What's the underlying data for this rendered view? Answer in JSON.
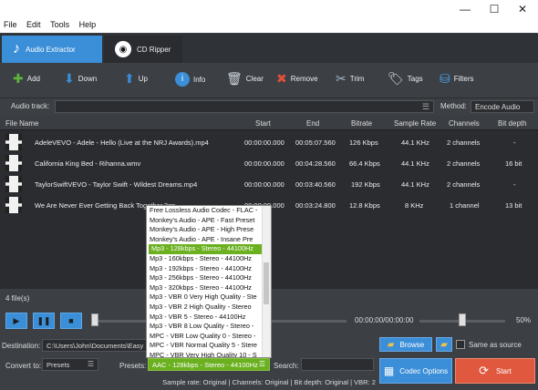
{
  "menu": [
    "File",
    "Edit",
    "Tools",
    "Help"
  ],
  "window_controls": {
    "minimize": "—",
    "maximize": "☐",
    "close": "✕"
  },
  "tabs": [
    {
      "label": "Audio Extractor",
      "icon": "music-note-icon",
      "active": true
    },
    {
      "label": "CD Ripper",
      "icon": "cd-icon",
      "active": false
    }
  ],
  "toolbar": {
    "add": "Add",
    "down": "Down",
    "up": "Up",
    "info": "Info",
    "clear": "Clear",
    "remove": "Remove",
    "trim": "Trim",
    "tags": "Tags",
    "filters": "Filters"
  },
  "audio_track": {
    "label": "Audio track:",
    "method_label": "Method:",
    "method_value": "Encode Audio"
  },
  "columns": {
    "file_name": "File Name",
    "start": "Start",
    "end": "End",
    "bitrate": "Bitrate",
    "sample_rate": "Sample Rate",
    "channels": "Channels",
    "bit_depth": "Bit depth"
  },
  "rows": [
    {
      "name": "AdeleVEVO - Adele - Hello (Live at the NRJ Awards).mp4",
      "start": "00:00:00.000",
      "end": "00:05:07.560",
      "bitrate": "126 Kbps",
      "sample_rate": "44.1 KHz",
      "channels": "2 channels",
      "bit_depth": "-"
    },
    {
      "name": "California King Bed - Rihanna.wmv",
      "start": "00:00:00.000",
      "end": "00:04:28.560",
      "bitrate": "66.4 Kbps",
      "sample_rate": "44.1 KHz",
      "channels": "2 channels",
      "bit_depth": "16 bit"
    },
    {
      "name": "TaylorSwiftVEVO - Taylor Swift - Wildest Dreams.mp4",
      "start": "00:00:00.000",
      "end": "00:03:40.560",
      "bitrate": "192 Kbps",
      "sample_rate": "44.1 KHz",
      "channels": "2 channels",
      "bit_depth": "-"
    },
    {
      "name": "We Are Never Ever Getting Back Together.3gp",
      "start": "00:00:00.000",
      "end": "00:03:24.800",
      "bitrate": "12.8 Kbps",
      "sample_rate": "8 KHz",
      "channels": "1 channel",
      "bit_depth": "13 bit"
    }
  ],
  "file_count": "4 file(s)",
  "player": {
    "time": "00:00:00/00:00:00",
    "volume": "50%",
    "volume_level": 0.5
  },
  "destination": {
    "label": "Destination:",
    "path": "C:\\Users\\John\\Documents\\Easy",
    "browse": "Browse",
    "same_as_source": "Same as source"
  },
  "convert_to": {
    "label": "Convert to:",
    "value": "Presets"
  },
  "presets": {
    "label": "Presets:",
    "value": "AAC - 128kbps - Stereo - 44100Hz",
    "search_label": "Search:"
  },
  "codec_options": "Codec Options",
  "start_button": "Start",
  "status_bar": "Sample rate: Original | Channels: Original | Bit depth: Original | VBR: 2",
  "preset_options": [
    "Free Lossless Audio Codec - FLAC -",
    "Monkey's Audio - APE - Fast Preset",
    "Monkey's Audio - APE - High Prese",
    "Monkey's Audio - APE - Insane Pre",
    "Mp3 - 128kbps - Stereo - 44100Hz",
    "Mp3 - 160kbps - Stereo - 44100Hz",
    "Mp3 - 192kbps - Stereo - 44100Hz",
    "Mp3 - 256kbps - Stereo - 44100Hz",
    "Mp3 - 320kbps - Stereo - 44100Hz",
    "Mp3 - VBR 0 Very High Quality - Ste",
    "Mp3 - VBR 2 High Quality - Stereo",
    "Mp3 - VBR 5 - Stereo - 44100Hz",
    "Mp3 - VBR 8 Low Quality - Stereo -",
    "MPC - VBR Low Quality 0 - Stereo -",
    "MPC - VBR Normal Quality 5 - Stere",
    "MPC - VBR Very High Quality 10 - S"
  ],
  "selected_preset_index": 4,
  "colors": {
    "accent_blue": "#3b8ed8",
    "accent_green": "#6ab01f",
    "start_orange": "#e0583e",
    "background": "#3c3f44"
  }
}
